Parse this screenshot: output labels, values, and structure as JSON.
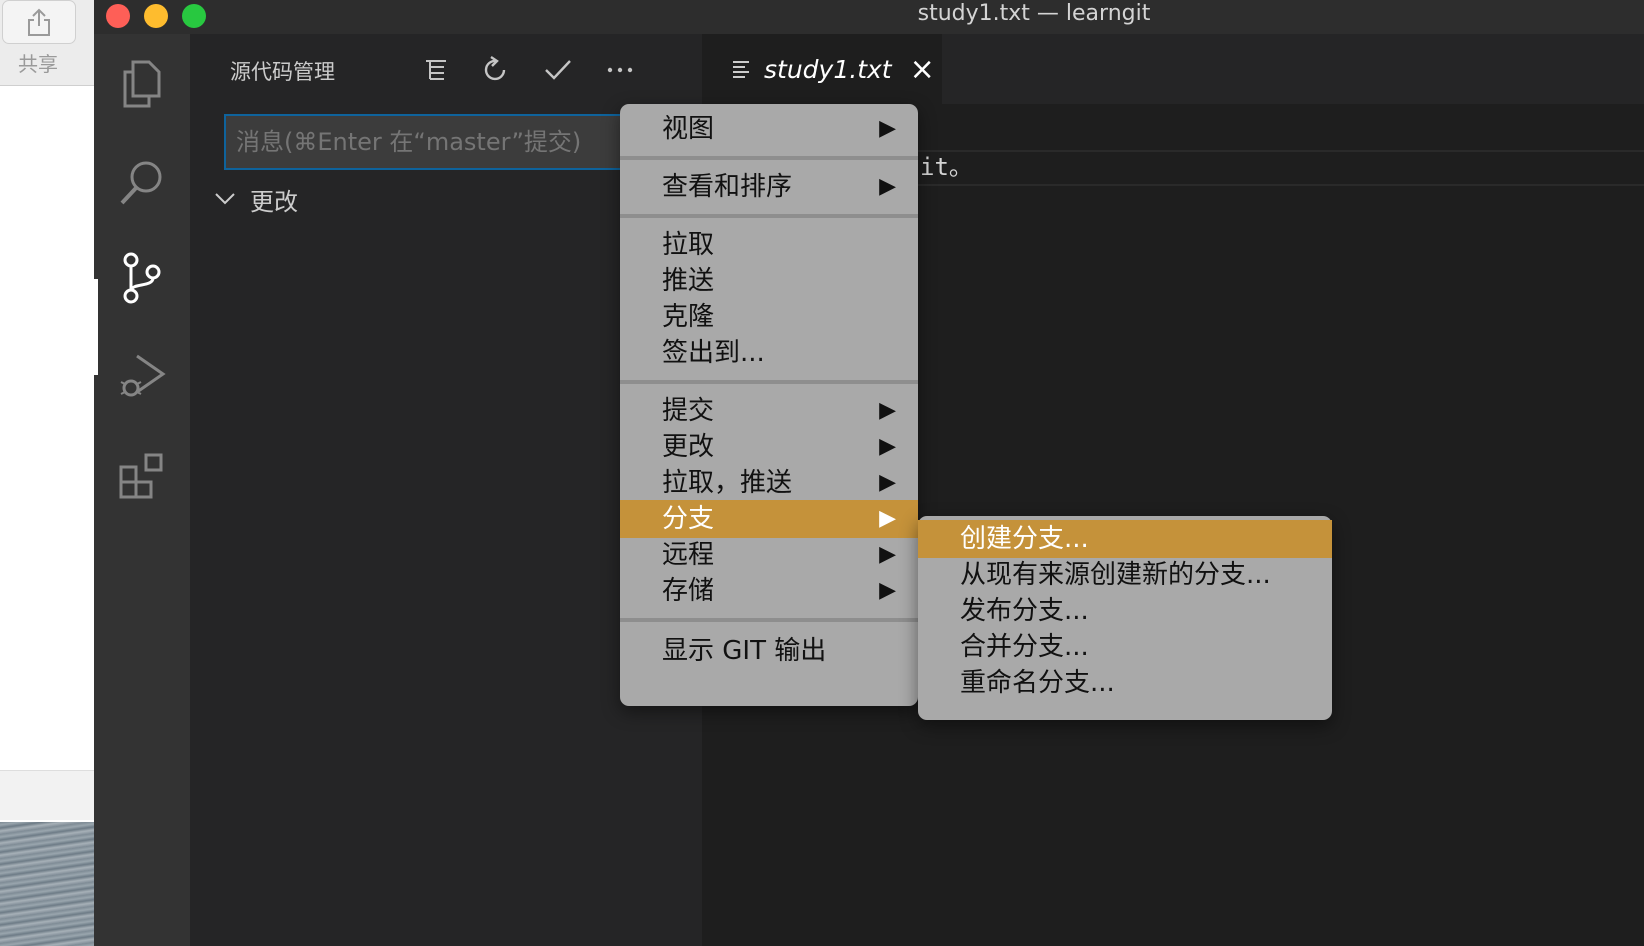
{
  "background_app": {
    "share_label": "共享"
  },
  "window": {
    "title": "study1.txt — learngit",
    "traffic_colors": [
      "#fe5f57",
      "#febc2e",
      "#28c840"
    ]
  },
  "activity_bar": {
    "icons": [
      "explorer-icon",
      "search-icon",
      "source-control-icon",
      "run-debug-icon",
      "extensions-icon"
    ],
    "active": "source-control-icon"
  },
  "sidebar": {
    "title": "源代码管理",
    "actions": [
      "tree-view-icon",
      "refresh-icon",
      "commit-check-icon",
      "more-actions-icon"
    ],
    "commit_placeholder": "消息(⌘Enter 在“master”提交)",
    "changes_label": "更改"
  },
  "editor": {
    "tab": {
      "title": "study1.txt",
      "close": "×"
    },
    "visible_text": "it。"
  },
  "menu": {
    "groups": [
      [
        {
          "label": "视图",
          "submenu": true
        }
      ],
      [
        {
          "label": "查看和排序",
          "submenu": true
        }
      ],
      [
        {
          "label": "拉取"
        },
        {
          "label": "推送"
        },
        {
          "label": "克隆"
        },
        {
          "label": "签出到..."
        }
      ],
      [
        {
          "label": "提交",
          "submenu": true
        },
        {
          "label": "更改",
          "submenu": true
        },
        {
          "label": "拉取，推送",
          "submenu": true
        },
        {
          "label": "分支",
          "submenu": true,
          "highlighted": true
        },
        {
          "label": "远程",
          "submenu": true
        },
        {
          "label": "存储",
          "submenu": true
        }
      ],
      [
        {
          "label": "显示 GIT 输出"
        }
      ]
    ],
    "submenu_arrow": "▶"
  },
  "branch_submenu": {
    "items": [
      {
        "label": "创建分支...",
        "highlighted": true
      },
      {
        "label": "从现有来源创建新的分支..."
      },
      {
        "label": "发布分支..."
      },
      {
        "label": "合并分支..."
      },
      {
        "label": "重命名分支..."
      }
    ]
  },
  "colors": {
    "highlight": "#c5923a",
    "focus_border": "#0e639c"
  }
}
